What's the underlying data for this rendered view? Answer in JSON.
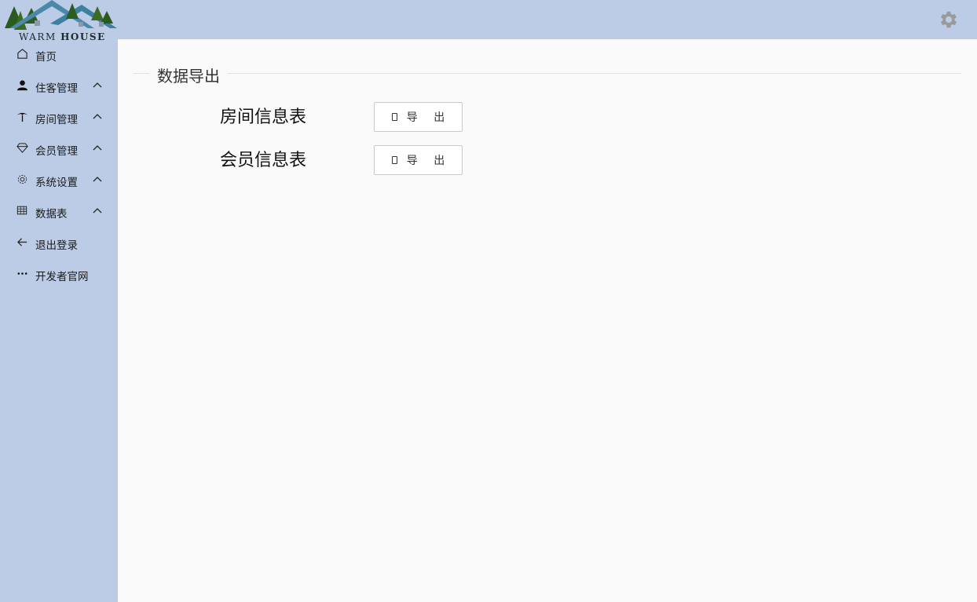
{
  "logo": {
    "text_light": "WARM",
    "text_bold": "HOUSE"
  },
  "header": {
    "settings_icon": "gear-icon"
  },
  "sidebar": {
    "items": [
      {
        "label": "首页",
        "icon": "home-icon",
        "has_chevron": false
      },
      {
        "label": "住客管理",
        "icon": "user-icon",
        "has_chevron": true
      },
      {
        "label": "房间管理",
        "icon": "palm-tree-icon",
        "has_chevron": true
      },
      {
        "label": "会员管理",
        "icon": "diamond-icon",
        "has_chevron": true
      },
      {
        "label": "系统设置",
        "icon": "gear-icon",
        "has_chevron": true
      },
      {
        "label": "数据表",
        "icon": "table-icon",
        "has_chevron": true
      },
      {
        "label": "退出登录",
        "icon": "arrow-left-icon",
        "has_chevron": false
      },
      {
        "label": "开发者官网",
        "icon": "more-icon",
        "has_chevron": false
      }
    ]
  },
  "main": {
    "section_title": "数据导出",
    "rows": [
      {
        "label": "房间信息表",
        "button_label": "导 出"
      },
      {
        "label": "会员信息表",
        "button_label": "导 出"
      }
    ]
  },
  "colors": {
    "sidebar_bg": "#bccce6",
    "main_bg": "#fafafa",
    "gear": "#9a9a9a"
  }
}
